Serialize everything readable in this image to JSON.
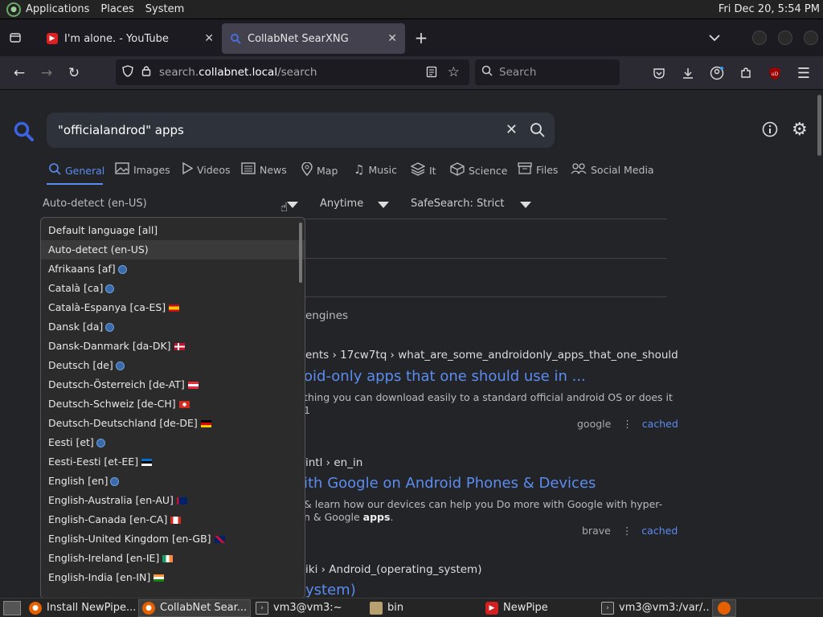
{
  "system_bar": {
    "menus": [
      "Applications",
      "Places",
      "System"
    ],
    "clock": "Fri Dec 20,  5:54 PM"
  },
  "tabs": [
    {
      "title": "I'm alone. - YouTube",
      "active": false
    },
    {
      "title": "CollabNet SearXNG",
      "active": true
    }
  ],
  "nav": {
    "url_prefix": "search.",
    "url_domain": "collabnet.local",
    "url_path": "/search",
    "search_placeholder": "Search"
  },
  "search": {
    "query": "\"officialandrod\"  apps"
  },
  "categories": [
    "General",
    "Images",
    "Videos",
    "News",
    "Map",
    "Music",
    "It",
    "Science",
    "Files",
    "Social Media"
  ],
  "filters": {
    "language": "Auto-detect (en-US)",
    "time": "Anytime",
    "safesearch": "SafeSearch: Strict"
  },
  "language_options": [
    {
      "label": "Default language [all]",
      "mark": ""
    },
    {
      "label": "Auto-detect (en-US)",
      "mark": "",
      "selected": true
    },
    {
      "label": "Afrikaans [af]",
      "mark": "globe"
    },
    {
      "label": "Català [ca]",
      "mark": "globe"
    },
    {
      "label": "Català-Espanya [ca-ES]",
      "mark": "es"
    },
    {
      "label": "Dansk [da]",
      "mark": "globe"
    },
    {
      "label": "Dansk-Danmark [da-DK]",
      "mark": "dk"
    },
    {
      "label": "Deutsch [de]",
      "mark": "globe"
    },
    {
      "label": "Deutsch-Österreich [de-AT]",
      "mark": "at"
    },
    {
      "label": "Deutsch-Schweiz [de-CH]",
      "mark": "ch"
    },
    {
      "label": "Deutsch-Deutschland [de-DE]",
      "mark": "de"
    },
    {
      "label": "Eesti [et]",
      "mark": "globe"
    },
    {
      "label": "Eesti-Eesti [et-EE]",
      "mark": "ee"
    },
    {
      "label": "English [en]",
      "mark": "globe"
    },
    {
      "label": "English-Australia [en-AU]",
      "mark": "au"
    },
    {
      "label": "English-Canada [en-CA]",
      "mark": "ca"
    },
    {
      "label": "English-United Kingdom [en-GB]",
      "mark": "gb"
    },
    {
      "label": "English-Ireland [en-IE]",
      "mark": "ie"
    },
    {
      "label": "English-India [en-IN]",
      "mark": "in"
    }
  ],
  "engines_text": "engines",
  "results": [
    {
      "url": "ents › 17cw7tq › what_are_some_androidonly_apps_that_one_should",
      "title": "oid-only apps that one should use in ...",
      "text1": "thing you can download easily to a standard official android OS or does it",
      "text2": "1",
      "engine": "google",
      "cached": "cached"
    },
    {
      "url": "intl › en_in",
      "title": "ith Google on Android Phones & Devices",
      "text1": "& learn how our devices can help you Do more with Google with hyper-",
      "text2_pre": "n & Google ",
      "text2_bold": "apps",
      "text2_post": ".",
      "engine": "brave",
      "cached": "cached"
    },
    {
      "url": "iki › Android_(operating_system)",
      "title": "ystem)"
    }
  ],
  "taskbar": [
    {
      "label": "Install NewPipe...",
      "icon": "firefox-icon",
      "active": false
    },
    {
      "label": "CollabNet Sear...",
      "icon": "firefox-icon",
      "active": true
    },
    {
      "label": "vm3@vm3:~",
      "icon": "terminal-icon",
      "active": false
    },
    {
      "label": "bin",
      "icon": "folder-icon",
      "active": false
    },
    {
      "label": "NewPipe",
      "icon": "newpipe-icon",
      "active": false
    },
    {
      "label": "vm3@vm3:/var/...",
      "icon": "terminal-icon",
      "active": false
    }
  ],
  "colors": {
    "accent": "#5c8cef",
    "page_bg": "#222428"
  }
}
